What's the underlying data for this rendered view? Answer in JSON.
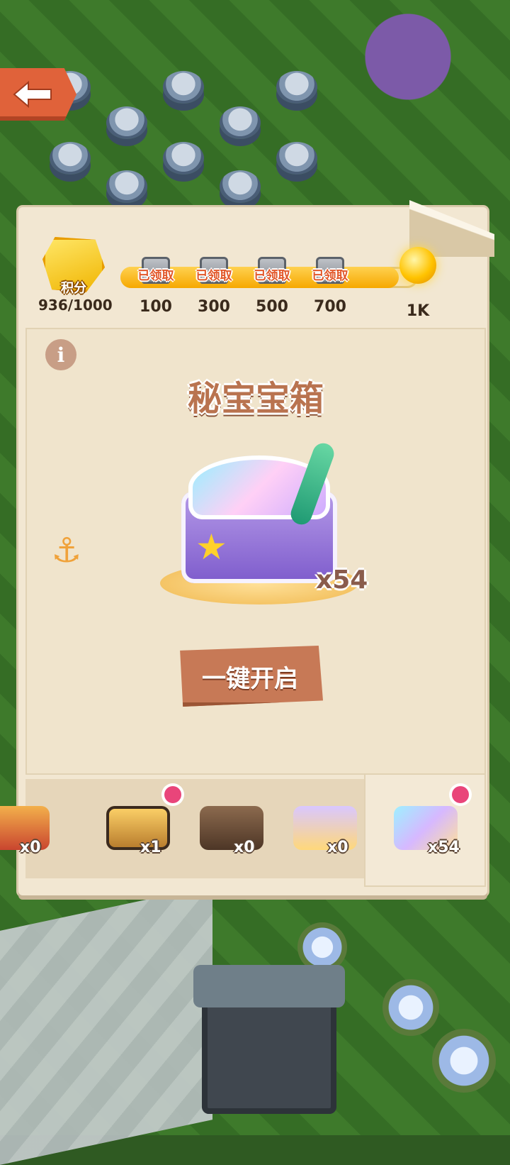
{
  "header": {
    "points_label": "积分",
    "points_value": "936/1000",
    "progress_fraction": 0.936,
    "milestones": [
      {
        "value": "100",
        "status": "已领取"
      },
      {
        "value": "300",
        "status": "已领取"
      },
      {
        "value": "500",
        "status": "已领取"
      },
      {
        "value": "700",
        "status": "已领取"
      }
    ],
    "final_reward_value": "1K"
  },
  "main": {
    "info_icon": "i",
    "title": "秘宝宝箱",
    "count": "x54",
    "open_all_label": "一键开启",
    "anchor_icon": "⚓"
  },
  "selector": {
    "items": [
      {
        "count": "x0"
      },
      {
        "count": "x1"
      },
      {
        "count": "x0"
      },
      {
        "count": "x0"
      },
      {
        "count": "x54"
      }
    ]
  },
  "colors": {
    "parchment": "#f2e7d2",
    "accent_orange": "#e0623a",
    "title_brown": "#b9734f",
    "badge_pink": "#e9457a",
    "progress_gold": "#f6a800"
  }
}
